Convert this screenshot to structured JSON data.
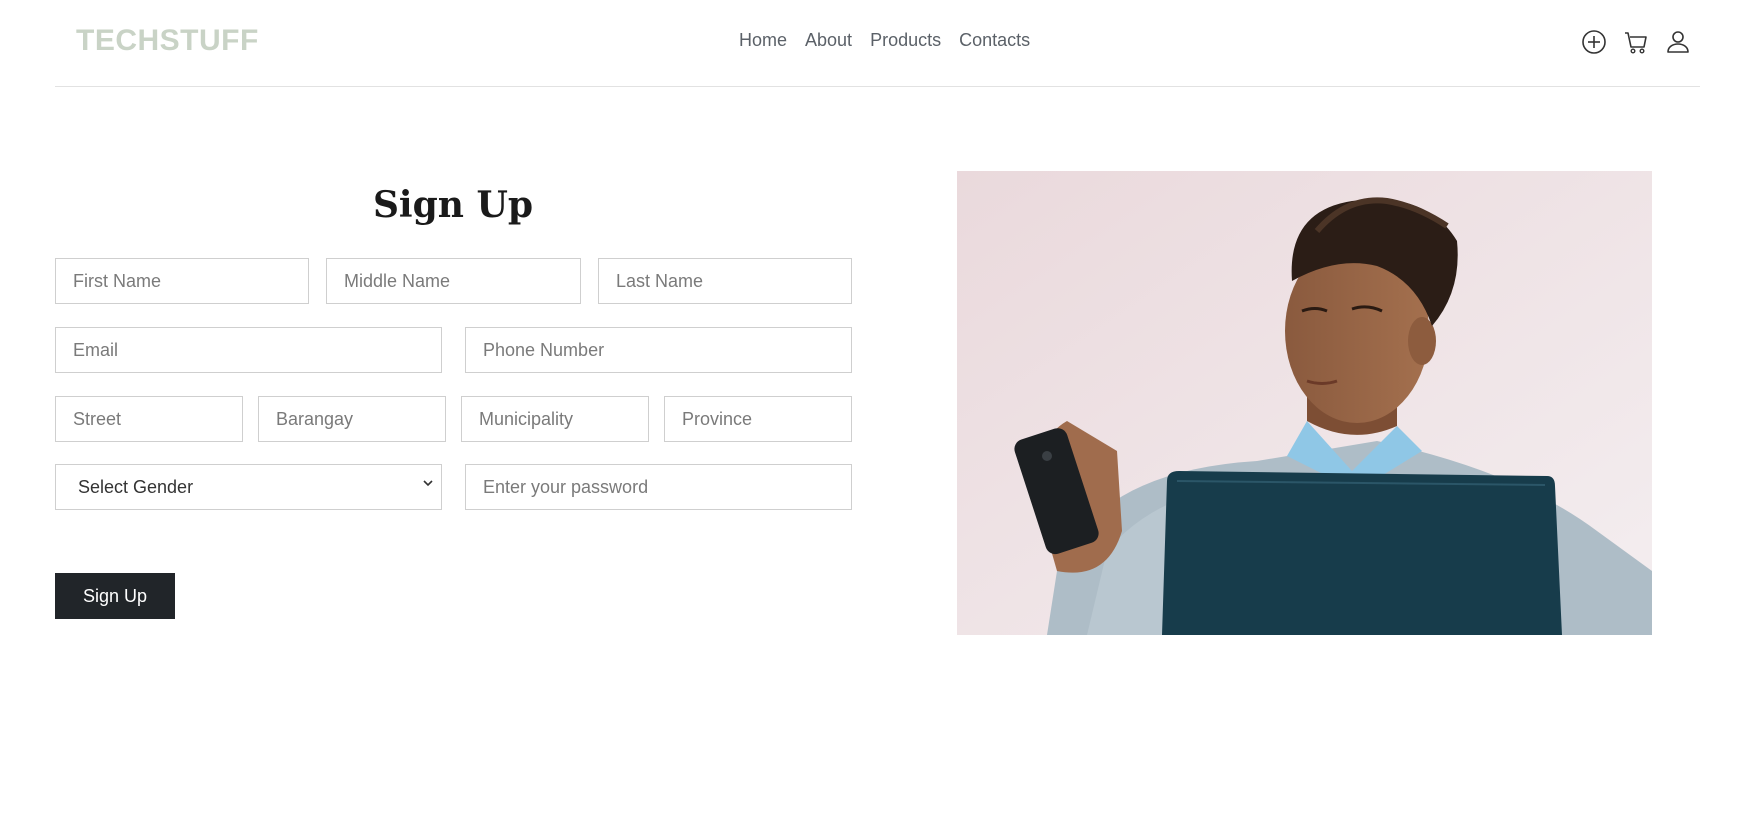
{
  "header": {
    "logo": "TECHSTUFF",
    "nav": [
      "Home",
      "About",
      "Products",
      "Contacts"
    ],
    "icons": [
      "plus-circle-icon",
      "cart-icon",
      "user-icon"
    ]
  },
  "form": {
    "title": "Sign Up",
    "fields": {
      "first_name": "First Name",
      "middle_name": "Middle Name",
      "last_name": "Last Name",
      "email": "Email",
      "phone": "Phone Number",
      "street": "Street",
      "barangay": "Barangay",
      "municipality": "Municipality",
      "province": "Province",
      "password": "Enter your password"
    },
    "gender_select": {
      "selected": "Select Gender"
    },
    "submit_label": "Sign Up"
  },
  "image": {
    "subject": "person-with-phone-and-laptop"
  },
  "colors": {
    "logo": "#c9d3c6",
    "button": "#212529",
    "border": "#cfcfcf"
  }
}
